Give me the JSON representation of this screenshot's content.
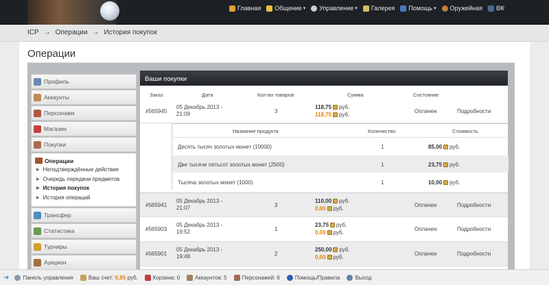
{
  "header": {
    "nav": [
      {
        "label": "Главная",
        "icon": "home-icon",
        "color": "#e0a030",
        "caret": false
      },
      {
        "label": "Общение",
        "icon": "chat-icon",
        "color": "#e8c040",
        "caret": true
      },
      {
        "label": "Управление",
        "icon": "gear-icon",
        "color": "#cfcfcf",
        "caret": true
      },
      {
        "label": "Галерея",
        "icon": "gallery-icon",
        "color": "#d5c060",
        "caret": false
      },
      {
        "label": "Помощь",
        "icon": "help-icon",
        "color": "#4a78c0",
        "caret": true
      },
      {
        "label": "Оружейная",
        "icon": "armory-icon",
        "color": "#c08040",
        "caret": false
      },
      {
        "label": "ВК",
        "icon": "vk-icon",
        "color": "#4a6a9a",
        "caret": false
      }
    ],
    "caret_symbol": "▾",
    "search_icon": "⌕"
  },
  "breadcrumb": {
    "items": [
      "ICP",
      "Операции",
      "История покупок"
    ],
    "separator": "→"
  },
  "page_title": "Операции",
  "sidebar": {
    "items_top": [
      {
        "label": "Профиль",
        "icon": "profile-icon",
        "color": "#6a8ab0"
      },
      {
        "label": "Аккаунты",
        "icon": "accounts-icon",
        "color": "#c08a50"
      },
      {
        "label": "Персонажи",
        "icon": "characters-icon",
        "color": "#b05a40"
      },
      {
        "label": "Магазин",
        "icon": "shop-icon",
        "color": "#c04040"
      },
      {
        "label": "Покупки",
        "icon": "purchases-icon",
        "color": "#b06a50"
      }
    ],
    "open_section": {
      "label": "Операции",
      "subs": [
        {
          "label": "Неподтверждённые действия",
          "bold": false
        },
        {
          "label": "Очередь передачи предметов",
          "bold": false
        },
        {
          "label": "История покупок",
          "bold": true
        },
        {
          "label": "История операций",
          "bold": false
        }
      ]
    },
    "items_bottom": [
      {
        "label": "Трансфер",
        "icon": "transfer-icon",
        "color": "#4a90c0"
      },
      {
        "label": "Статистика",
        "icon": "stats-icon",
        "color": "#6a9a50"
      },
      {
        "label": "Турниры",
        "icon": "trophy-icon",
        "color": "#d0a030"
      },
      {
        "label": "Аукцион",
        "icon": "auction-icon",
        "color": "#a07040"
      }
    ]
  },
  "purchases": {
    "title": "Ваши покупки",
    "columns": [
      "Заказ",
      "Дата",
      "Кол-во товаров",
      "Сумма",
      "Состояние"
    ],
    "currency": "руб.",
    "details_label": "Подробности",
    "orders": [
      {
        "id": "#565945",
        "date": "05 Декабрь 2013 -",
        "time": "21:09",
        "qty": "3",
        "sum": "118,75",
        "bonus": "118,75",
        "status": "Оплачен"
      },
      {
        "id": "#565941",
        "date": "05 Декабрь 2013 -",
        "time": "21:07",
        "qty": "3",
        "sum": "110,00",
        "bonus": "0,00",
        "status": "Оплачен"
      },
      {
        "id": "#565903",
        "date": "05 Декабрь 2013 -",
        "time": "19:52",
        "qty": "1",
        "sum": "23,75",
        "bonus": "0,00",
        "status": "Оплачен"
      },
      {
        "id": "#565901",
        "date": "05 Декабрь 2013 -",
        "time": "19:48",
        "qty": "2",
        "sum": "250,00",
        "bonus": "0,00",
        "status": "Оплачен"
      }
    ],
    "detail": {
      "columns": [
        "Название продукта",
        "Количество",
        "Стоимость"
      ],
      "rows": [
        {
          "name": "Десять тысяч золотых монет (10000)",
          "qty": "1",
          "cost": "85,00"
        },
        {
          "name": "Две тысячи пятьсот золотых монет (2500)",
          "qty": "1",
          "cost": "23,75"
        },
        {
          "name": "Тысяча золотых монет (1000)",
          "qty": "1",
          "cost": "10,00"
        }
      ]
    }
  },
  "footer": {
    "items": [
      {
        "label": "Панель управления",
        "icon": "panel-icon",
        "color": "#8a9aa8"
      },
      {
        "label": "Ваш счет:",
        "icon": "wallet-icon",
        "color": "#c8a060"
      },
      {
        "label": "Корзина: 0",
        "icon": "cart-icon",
        "color": "#c04040"
      },
      {
        "label": "Аккаунтов: 5",
        "icon": "accounts-icon",
        "color": "#a08060"
      },
      {
        "label": "Персонажей: 6",
        "icon": "characters-icon",
        "color": "#a07050"
      },
      {
        "label": "Помощь/Правила",
        "icon": "info-icon",
        "color": "#3060b0"
      },
      {
        "label": "Выход",
        "icon": "logout-icon",
        "color": "#6080a0"
      }
    ],
    "balance": "6,85",
    "balance_currency": "руб.",
    "balance_color": "#e38000",
    "arrow": "➜"
  }
}
